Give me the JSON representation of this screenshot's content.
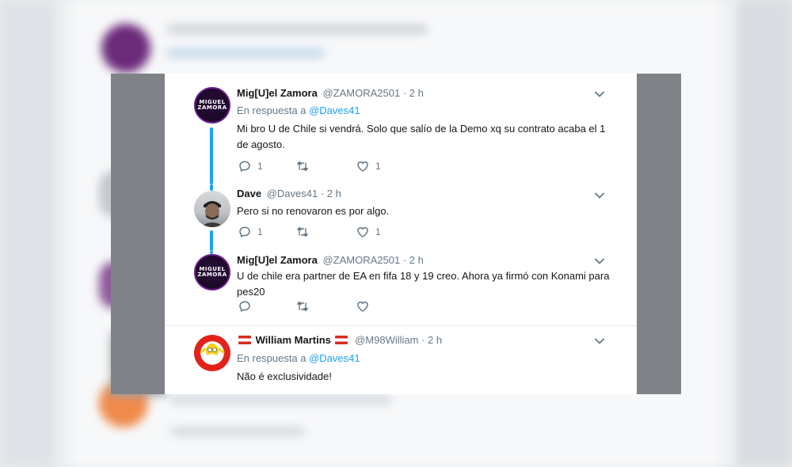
{
  "tweets": [
    {
      "name": "Mig[U]el Zamora",
      "handle": "@ZAMORA2501",
      "time": "· 2 h",
      "reply_prefix": "En respuesta a",
      "reply_to": "@Daves41",
      "text": "Mi bro U de Chile si vendrá. Solo que salío de la Demo xq su contrato acaba el 1 de agosto.",
      "reply_count": "1",
      "retweet_count": "",
      "like_count": "1",
      "avatar_text": "MIGUEL ZAMORA"
    },
    {
      "name": "Dave",
      "handle": "@Daves41",
      "time": "· 2 h",
      "text": "Pero si no renovaron es por algo.",
      "reply_count": "1",
      "retweet_count": "",
      "like_count": "1"
    },
    {
      "name": "Mig[U]el Zamora",
      "handle": "@ZAMORA2501",
      "time": "· 2 h",
      "text": "U de chile era partner de EA en fifa 18 y 19 creo. Ahora ya firmó con Konami para pes20",
      "reply_count": "",
      "retweet_count": "",
      "like_count": "",
      "avatar_text": "MIGUEL ZAMORA"
    },
    {
      "name": "William Martins",
      "handle": "@M98William",
      "time": "· 2 h",
      "reply_prefix": "En respuesta a",
      "reply_to": "@Daves41",
      "text": "Não é exclusividade!"
    }
  ],
  "colors": {
    "accent": "#1da1f2",
    "text": "#14171a",
    "muted": "#657786",
    "avatar_purple_ring": "#6a1d8c"
  },
  "icons": {
    "reply": "reply-icon",
    "retweet": "retweet-icon",
    "like": "heart-icon",
    "caret": "chevron-down-icon"
  }
}
